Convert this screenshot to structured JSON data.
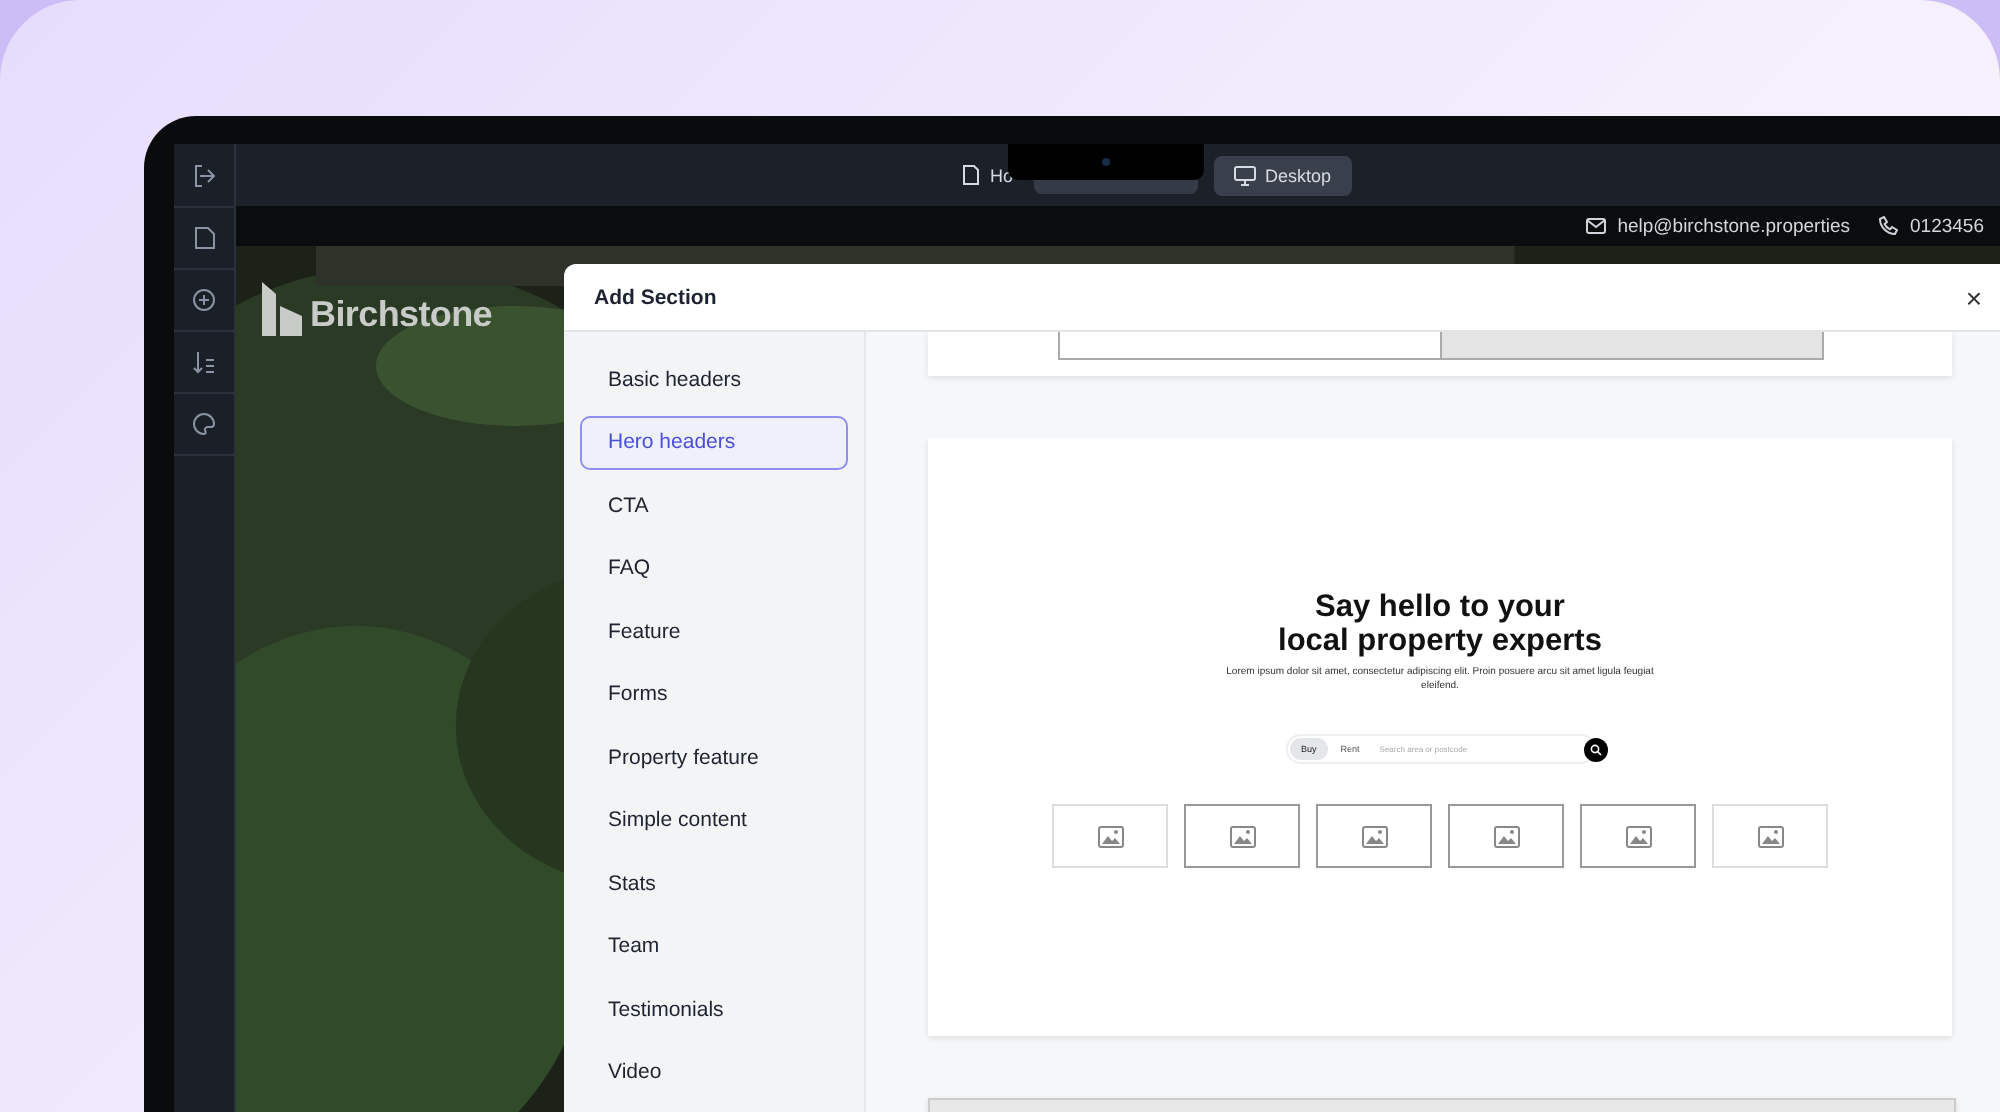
{
  "toolbar": {
    "tabs": [
      {
        "label": "Ho",
        "selected": false
      },
      {
        "label": "Desktop",
        "selected": true
      }
    ]
  },
  "contact": {
    "email": "help@birchstone.properties",
    "phone": "0123456"
  },
  "site": {
    "logo": "Birchstone"
  },
  "modal": {
    "title": "Add Section",
    "close": "×",
    "categories": [
      {
        "label": "Basic headers",
        "selected": false
      },
      {
        "label": "Hero headers",
        "selected": true
      },
      {
        "label": "CTA",
        "selected": false
      },
      {
        "label": "FAQ",
        "selected": false
      },
      {
        "label": "Feature",
        "selected": false
      },
      {
        "label": "Forms",
        "selected": false
      },
      {
        "label": "Property feature",
        "selected": false
      },
      {
        "label": "Simple content",
        "selected": false
      },
      {
        "label": "Stats",
        "selected": false
      },
      {
        "label": "Team",
        "selected": false
      },
      {
        "label": "Testimonials",
        "selected": false
      },
      {
        "label": "Video",
        "selected": false
      }
    ],
    "preview": {
      "heading_lines": [
        "Say hello to your",
        "local property experts"
      ],
      "body": "Lorem ipsum dolor sit amet, consectetur adipiscing elit. Proin posuere arcu sit amet ligula feugiat eleifend.",
      "search_tabs": [
        {
          "label": "Buy",
          "selected": true
        },
        {
          "label": "Rent",
          "selected": false
        }
      ],
      "search_placeholder": "Search area or postcode"
    }
  }
}
